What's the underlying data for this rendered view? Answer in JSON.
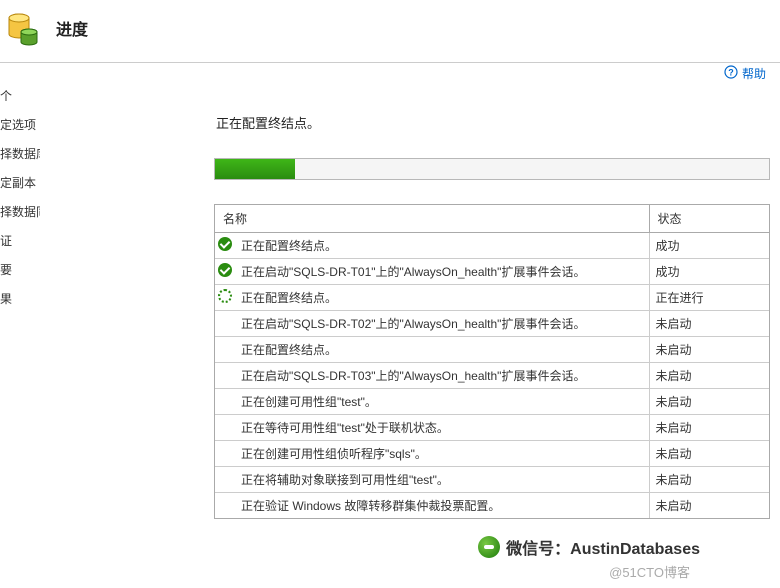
{
  "header": {
    "title": "进度"
  },
  "help": {
    "label": "帮助"
  },
  "sidebar": {
    "items": [
      {
        "label": "个"
      },
      {
        "label": "定选项"
      },
      {
        "label": "择数据库"
      },
      {
        "label": "定副本"
      },
      {
        "label": "择数据同步"
      },
      {
        "label": "证"
      },
      {
        "label": "要"
      },
      {
        "label": "果"
      }
    ]
  },
  "main": {
    "status_text": "正在配置终结点。",
    "progress_percent": 14.5,
    "table": {
      "head_icon": "",
      "head_name": "名称",
      "head_status": "状态",
      "rows": [
        {
          "icon": "success",
          "name": "正在配置终结点。",
          "status": "成功"
        },
        {
          "icon": "success",
          "name": "正在启动\"SQLS-DR-T01\"上的\"AlwaysOn_health\"扩展事件会话。",
          "status": "成功"
        },
        {
          "icon": "running",
          "name": "正在配置终结点。",
          "status": "正在进行"
        },
        {
          "icon": "none",
          "name": "正在启动\"SQLS-DR-T02\"上的\"AlwaysOn_health\"扩展事件会话。",
          "status": "未启动"
        },
        {
          "icon": "none",
          "name": "正在配置终结点。",
          "status": "未启动"
        },
        {
          "icon": "none",
          "name": "正在启动\"SQLS-DR-T03\"上的\"AlwaysOn_health\"扩展事件会话。",
          "status": "未启动"
        },
        {
          "icon": "none",
          "name": "正在创建可用性组\"test\"。",
          "status": "未启动"
        },
        {
          "icon": "none",
          "name": "正在等待可用性组\"test\"处于联机状态。",
          "status": "未启动"
        },
        {
          "icon": "none",
          "name": "正在创建可用性组侦听程序\"sqls\"。",
          "status": "未启动"
        },
        {
          "icon": "none",
          "name": "正在将辅助对象联接到可用性组\"test\"。",
          "status": "未启动"
        },
        {
          "icon": "none",
          "name": "正在验证 Windows 故障转移群集仲裁投票配置。",
          "status": "未启动"
        }
      ]
    }
  },
  "watermark": {
    "line1": "微信号：AustinDatabases",
    "line2": "@51CTO博客"
  }
}
